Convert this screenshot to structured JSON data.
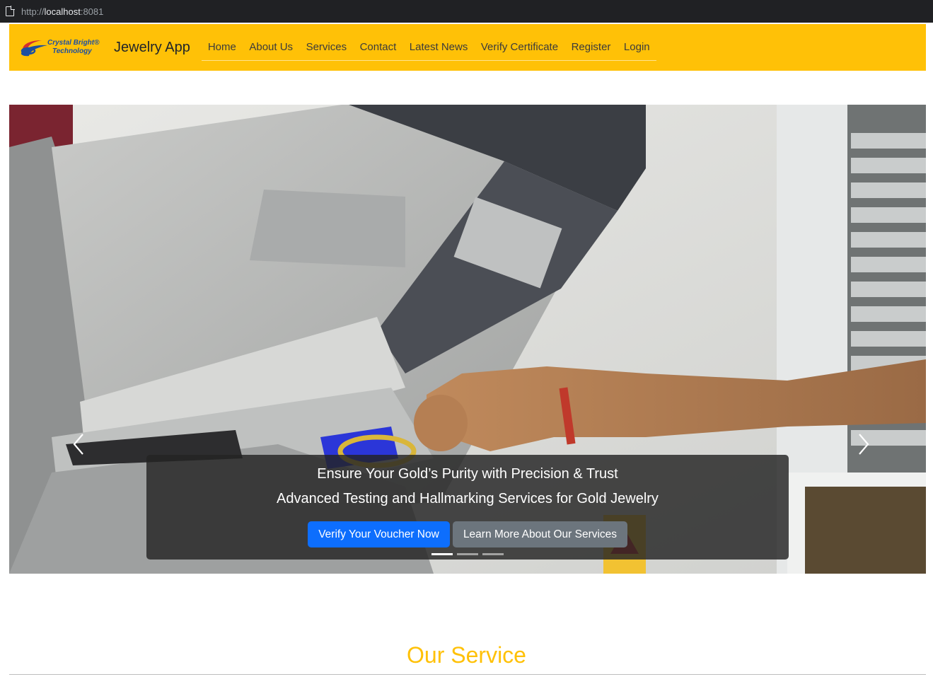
{
  "browser": {
    "url_scheme": "http://",
    "url_host": "localhost",
    "url_port": ":8081"
  },
  "navbar": {
    "logo_line1": "Crystal Bright®",
    "logo_line2": "Technology",
    "brand": "Jewelry App",
    "links": [
      "Home",
      "About Us",
      "Services",
      "Contact",
      "Latest News",
      "Verify Certificate",
      "Register",
      "Login"
    ],
    "background_color": "#ffc107"
  },
  "carousel": {
    "caption_line1": "Ensure Your Gold’s Purity with Precision & Trust",
    "caption_line2": "Advanced Testing and Hallmarking Services for Gold Jewelry",
    "primary_button": "Verify Your Voucher Now",
    "secondary_button": "Learn More About Our Services",
    "slide_count": 3,
    "active_slide": 1,
    "prev_icon": "chevron-left-icon",
    "next_icon": "chevron-right-icon"
  },
  "services": {
    "title": "Our Service",
    "title_color": "#ffc107"
  }
}
